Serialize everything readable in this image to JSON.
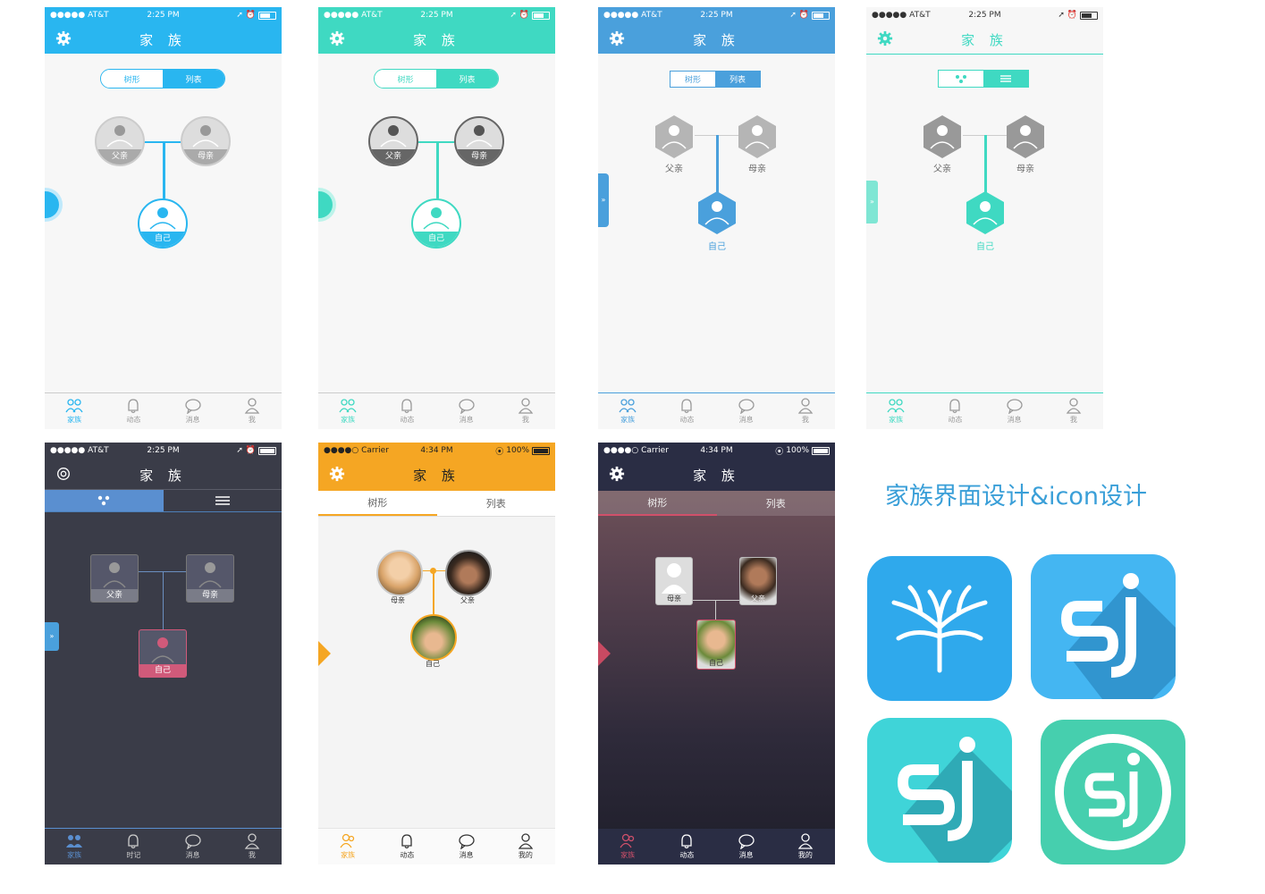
{
  "status": {
    "carrier_att": "●●●●● AT&T ",
    "carrier_c": "●●●●○ Carrier ",
    "time1": "2:25 PM",
    "time2": "4:34 PM",
    "battery_pct": "100%"
  },
  "nav_title": "家 族",
  "seg": {
    "tree": "树形",
    "list": "列表"
  },
  "people": {
    "father": "父亲",
    "mother": "母亲",
    "self": "自己"
  },
  "tabs": {
    "family": "家族",
    "feed": "动态",
    "msg": "消息",
    "me": "我",
    "timeline": "时记",
    "mine": "我的"
  },
  "headline": "家族界面设计&icon设计",
  "colors": {
    "blue": "#29b6f0",
    "teal": "#3fd9c2",
    "steel": "#4aa0dc",
    "orange": "#f5a623",
    "navy": "#2a2d44",
    "dark": "#3a3c48",
    "pink": "#d05a7a"
  }
}
